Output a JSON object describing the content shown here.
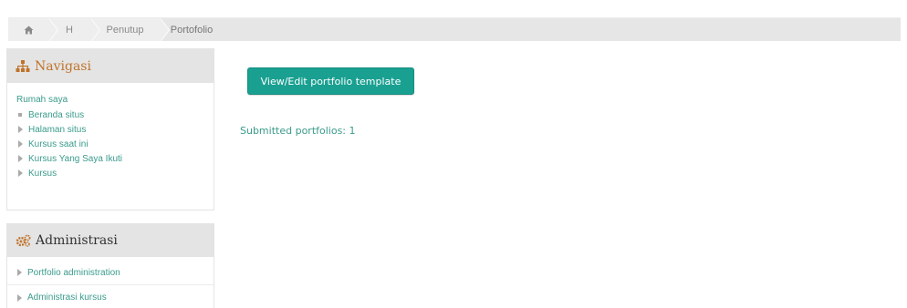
{
  "breadcrumb": {
    "home_icon": "home-icon",
    "items": [
      "H",
      "Penutup",
      "Portofolio"
    ]
  },
  "navigation": {
    "title": "Navigasi",
    "icon": "sitemap-icon",
    "top_link": "Rumah saya",
    "items": [
      {
        "label": "Beranda situs",
        "bullet": "square"
      },
      {
        "label": "Halaman situs",
        "bullet": "triangle"
      },
      {
        "label": "Kursus saat ini",
        "bullet": "triangle"
      },
      {
        "label": "Kursus Yang Saya Ikuti",
        "bullet": "triangle"
      },
      {
        "label": "Kursus",
        "bullet": "triangle"
      }
    ]
  },
  "administration": {
    "title": "Administrasi",
    "icon": "gears-icon",
    "items": [
      "Portfolio administration",
      "Administrasi kursus"
    ]
  },
  "main": {
    "button_label": "View/Edit portfolio template",
    "submitted_text": "Submitted portfolios: 1"
  },
  "colors": {
    "accent": "#1aa091",
    "link": "#3a9b8c",
    "header_orange": "#c0732b",
    "block_header_bg": "#e4e4e4"
  }
}
